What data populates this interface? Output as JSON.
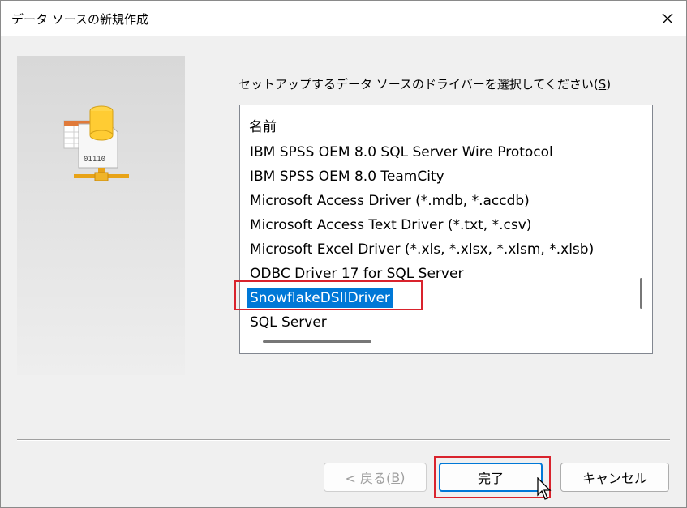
{
  "window": {
    "title": "データ ソースの新規作成"
  },
  "prompt": {
    "text": "セットアップするデータ ソースのドライバーを選択してください(",
    "mnemonic": "S",
    "suffix": ")"
  },
  "list": {
    "header": "名前",
    "items": [
      "IBM SPSS OEM 8.0 SQL Server Wire Protocol",
      "IBM SPSS OEM 8.0 TeamCity",
      "Microsoft Access Driver (*.mdb, *.accdb)",
      "Microsoft Access Text Driver (*.txt, *.csv)",
      "Microsoft Excel Driver (*.xls, *.xlsx, *.xlsm, *.xlsb)",
      "ODBC Driver 17 for SQL Server",
      "SnowflakeDSIIDriver",
      "SQL Server"
    ],
    "selected": "SnowflakeDSIIDriver"
  },
  "side_icon": {
    "label": "01110"
  },
  "buttons": {
    "back_prefix": "< 戻る(",
    "back_mnemonic": "B",
    "back_suffix": ")",
    "finish": "完了",
    "cancel": "キャンセル"
  },
  "colors": {
    "selection": "#0078d7",
    "highlight": "#d9232d"
  }
}
